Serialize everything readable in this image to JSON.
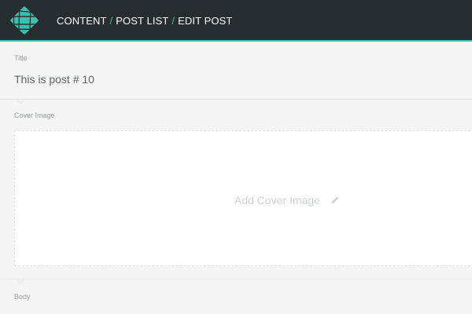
{
  "header": {
    "breadcrumb": [
      {
        "label": "CONTENT"
      },
      {
        "label": "POST LIST"
      },
      {
        "label": "EDIT POST"
      }
    ],
    "separator": "/"
  },
  "fields": {
    "title": {
      "label": "Title",
      "value": "This is post # 10"
    },
    "cover_image": {
      "label": "Cover Image",
      "placeholder": "Add Cover Image"
    },
    "body": {
      "label": "Body"
    }
  },
  "colors": {
    "topbar": "#252d2f",
    "accent": "#3cbfae",
    "background": "#f3f4f3"
  },
  "icons": {
    "logo": "netlify-logo-icon",
    "edit": "pencil-icon"
  }
}
